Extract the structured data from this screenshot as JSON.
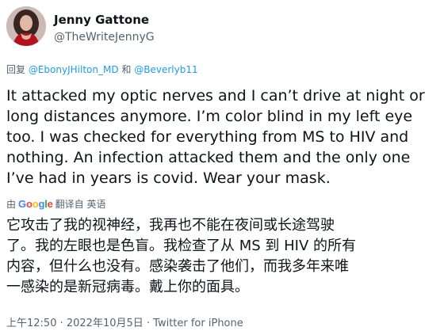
{
  "author": {
    "name": "Jenny Gattone",
    "handle": "@TheWriteJennyG"
  },
  "reply": {
    "prefix": "回复",
    "mention1": "@EbonyJHilton_MD",
    "conj": "和",
    "mention2": "@Beverlyb11"
  },
  "tweet_text": "It attacked my optic nerves and I can’t drive at night or\nlong distances anymore.  I’m color blind in my left eye\ntoo.  I was checked for everything from MS to HIV and\nnothing.  An infection attacked them and the only one\nI’ve had in years is covid.  Wear your mask.",
  "translation": {
    "by_icon": "由",
    "google": [
      "G",
      "o",
      "o",
      "g",
      "l",
      "e"
    ],
    "label": "翻译自 英语",
    "text": "它攻击了我的视神经，我再也不能在夜间或长途驾驶\n了。我的左眼也是色盲。我检查了从 MS 到 HIV 的所有\n内容，但什么也没有。感染袭击了他们，而我多年来唯\n一感染的是新冠病毒。戴上你的面具。"
  },
  "meta": {
    "timestamp": "上午12:50 · 2022年10月5日 · Twitter for iPhone"
  },
  "colors": {
    "link": "#1d9bf0",
    "secondary_text": "#536471",
    "primary_text": "#0f1419"
  }
}
